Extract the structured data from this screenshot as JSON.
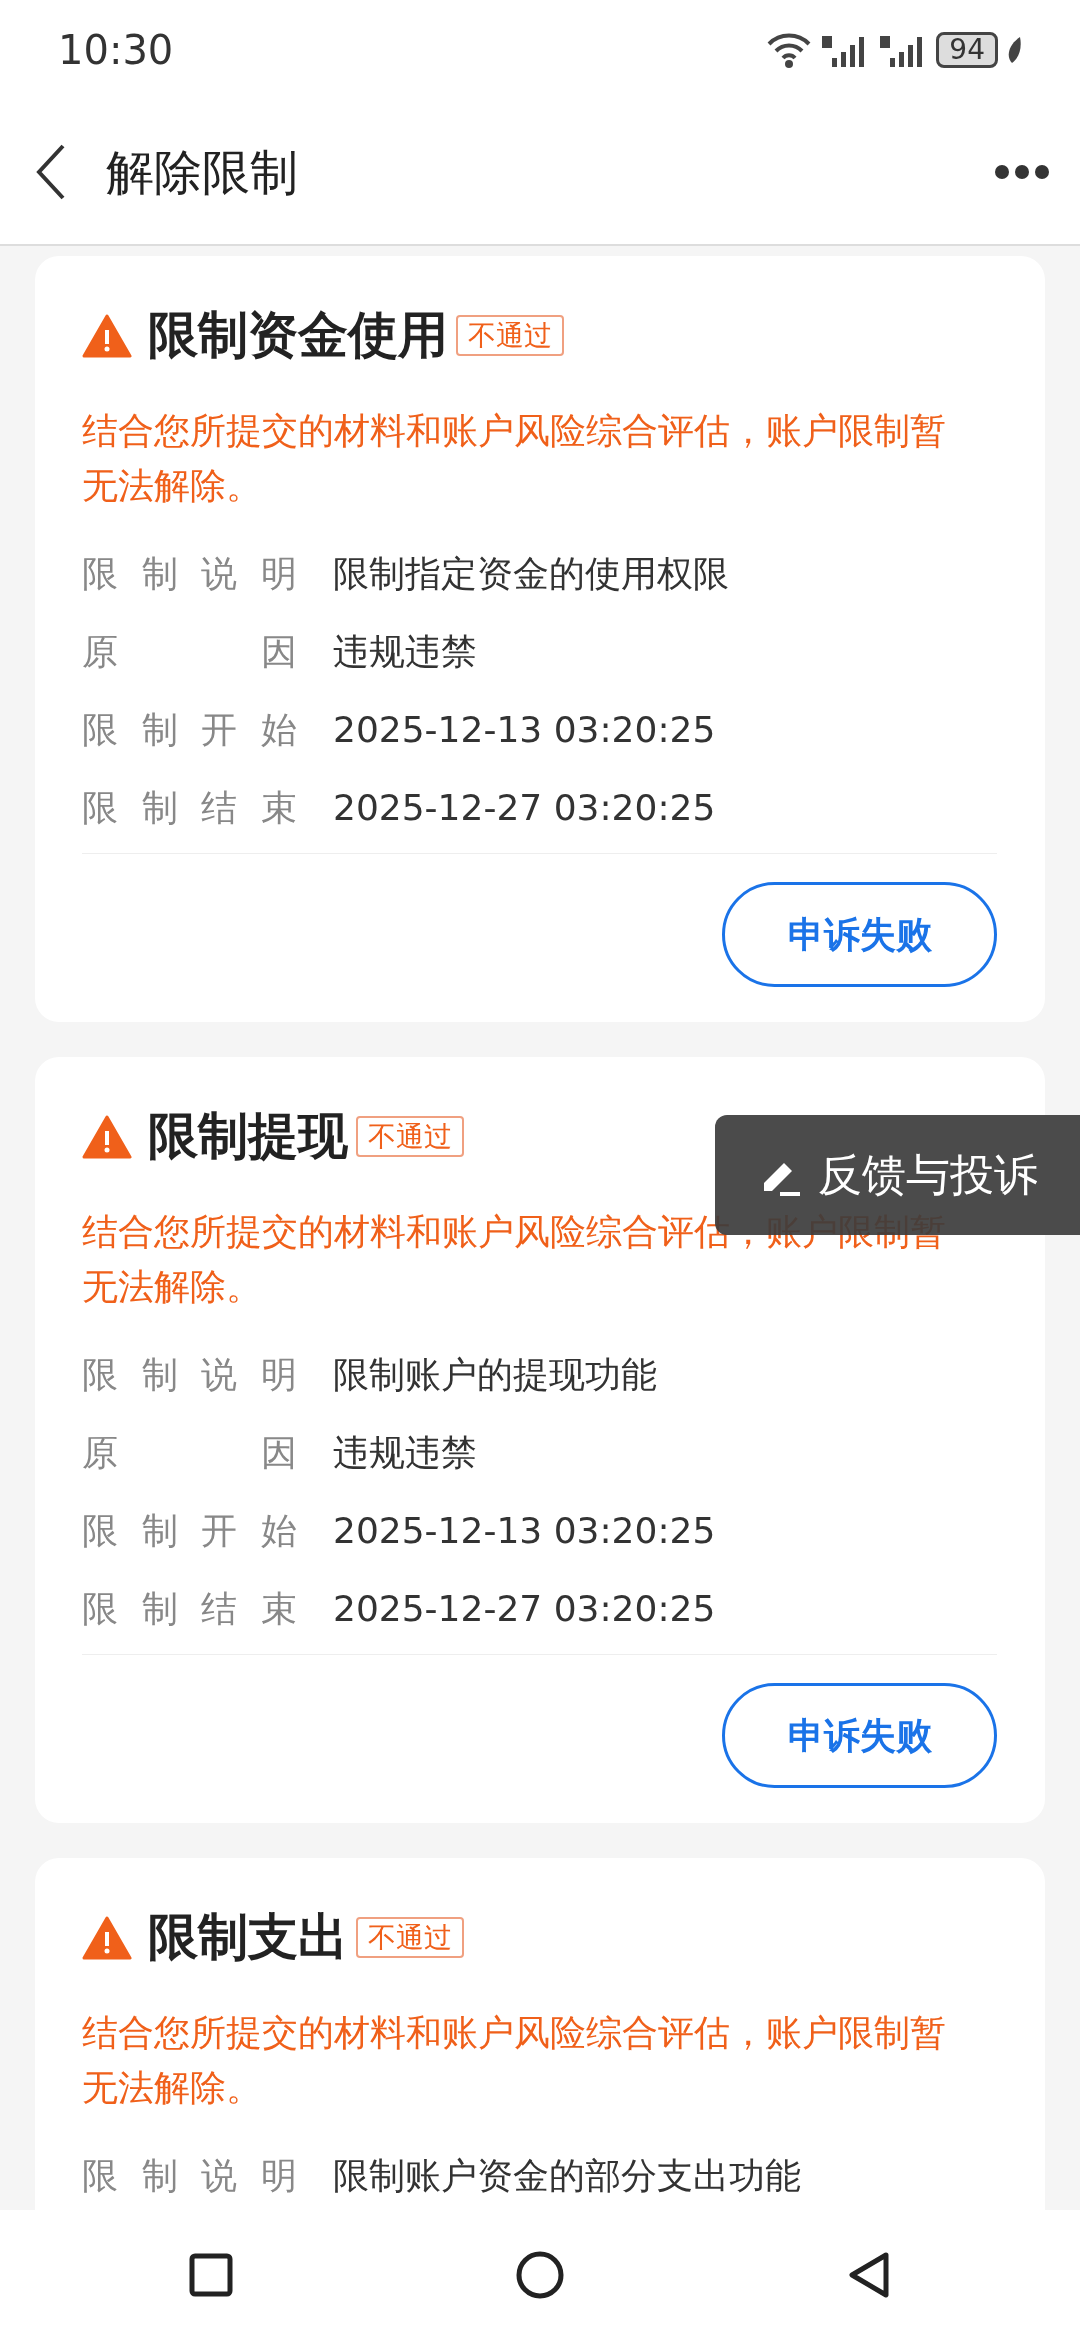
{
  "status_bar": {
    "time": "10:30",
    "battery": "94"
  },
  "header": {
    "title": "解除限制"
  },
  "cards": [
    {
      "title": "限制资金使用",
      "badge": "不通过",
      "message": "结合您所提交的材料和账户风险综合评估，账户限制暂无法解除。",
      "details": [
        {
          "label": "限制说明",
          "value": "限制指定资金的使用权限"
        },
        {
          "label": "原因",
          "value": "违规违禁"
        },
        {
          "label": "限制开始",
          "value": "2025-12-13 03:20:25"
        },
        {
          "label": "限制结束",
          "value": "2025-12-27 03:20:25"
        }
      ],
      "button": "申诉失败"
    },
    {
      "title": "限制提现",
      "badge": "不通过",
      "message": "结合您所提交的材料和账户风险综合评估，账户限制暂无法解除。",
      "details": [
        {
          "label": "限制说明",
          "value": "限制账户的提现功能"
        },
        {
          "label": "原因",
          "value": "违规违禁"
        },
        {
          "label": "限制开始",
          "value": "2025-12-13 03:20:25"
        },
        {
          "label": "限制结束",
          "value": "2025-12-27 03:20:25"
        }
      ],
      "button": "申诉失败"
    },
    {
      "title": "限制支出",
      "badge": "不通过",
      "message": "结合您所提交的材料和账户风险综合评估，账户限制暂无法解除。",
      "details": [
        {
          "label": "限制说明",
          "value": "限制账户资金的部分支出功能"
        }
      ]
    }
  ],
  "floating_button": {
    "label": "反馈与投诉"
  }
}
